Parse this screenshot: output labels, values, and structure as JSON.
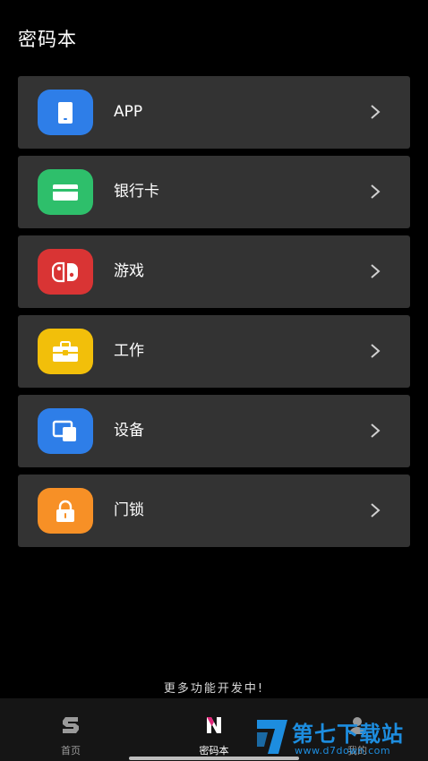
{
  "header": {
    "title": "密码本"
  },
  "colors": {
    "background": "#000000",
    "card": "#333333",
    "app": "#2e7ee8",
    "bank": "#2ebf6b",
    "games": "#d93434",
    "work": "#f2bf0a",
    "devices": "#2e7ee8",
    "door_lock": "#f79026",
    "watermark_blue": "#1d8ddf"
  },
  "categories": [
    {
      "label": "APP",
      "icon": "phone-icon"
    },
    {
      "label": "银行卡",
      "icon": "credit-card-icon"
    },
    {
      "label": "游戏",
      "icon": "game-controller-icon"
    },
    {
      "label": "工作",
      "icon": "briefcase-icon"
    },
    {
      "label": "设备",
      "icon": "devices-icon"
    },
    {
      "label": "门锁",
      "icon": "lock-icon"
    }
  ],
  "footer_hint": "更多功能开发中!",
  "tabbar": {
    "tabs": [
      {
        "label": "首页",
        "icon": "home-s-icon",
        "active": false
      },
      {
        "label": "密码本",
        "icon": "passbook-n-icon",
        "active": true
      },
      {
        "label": "我的",
        "icon": "profile-icon",
        "active": false
      }
    ]
  },
  "watermark": {
    "title": "第七下载站",
    "url": "www.d7down.com"
  }
}
